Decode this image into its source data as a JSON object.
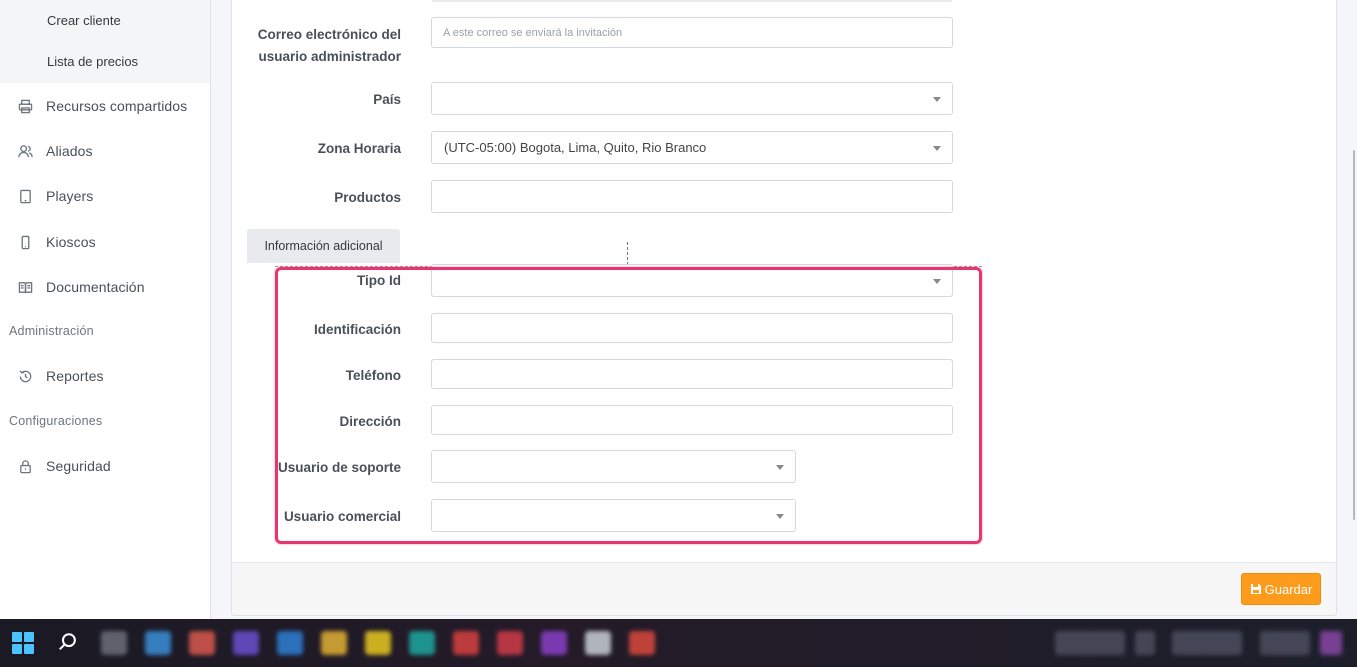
{
  "sidebar": {
    "sub_items": [
      {
        "label": "Crear cliente"
      },
      {
        "label": "Lista de precios"
      }
    ],
    "items": [
      {
        "label": "Recursos compartidos",
        "icon": "printer-icon"
      },
      {
        "label": "Aliados",
        "icon": "users-icon"
      },
      {
        "label": "Players",
        "icon": "tablet-icon"
      },
      {
        "label": "Kioscos",
        "icon": "phone-icon"
      },
      {
        "label": "Documentación",
        "icon": "book-icon"
      }
    ],
    "section_admin": "Administración",
    "admin_items": [
      {
        "label": "Reportes",
        "icon": "history-icon"
      }
    ],
    "section_config": "Configuraciones",
    "config_items": [
      {
        "label": "Seguridad",
        "icon": "lock-icon"
      }
    ]
  },
  "form": {
    "email_label": "Correo electrónico del usuario administrador",
    "email_placeholder": "A este correo se enviará la invitación",
    "country_label": "País",
    "country_value": "",
    "timezone_label": "Zona Horaria",
    "timezone_value": "(UTC-05:00) Bogota, Lima, Quito, Rio Branco",
    "products_label": "Productos",
    "products_value": "",
    "additional_tab": "Información adicional",
    "id_type_label": "Tipo Id",
    "id_label": "Identificación",
    "phone_label": "Teléfono",
    "address_label": "Dirección",
    "support_user_label": "Usuario de soporte",
    "sales_user_label": "Usuario comercial"
  },
  "footer": {
    "save_label": "Guardar"
  },
  "colors": {
    "accent_button": "#fd9b1c",
    "highlight_border": "#e8356d"
  }
}
